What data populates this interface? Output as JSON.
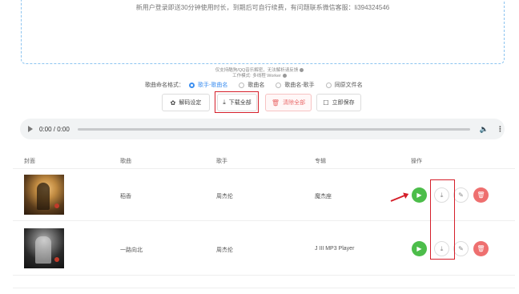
{
  "notice": "新用户登录即送30分钟使用时长，到期后可自行续费，有问题联系微信客服：li394324546",
  "process_note": {
    "line1": "仅支持酷狗/QQ音乐解密，无法解析请反馈",
    "line2": "工作模式: 多线程 Worker"
  },
  "format": {
    "label": "歌曲命名格式：",
    "options": [
      {
        "label": "歌手-歌曲名",
        "selected": true
      },
      {
        "label": "歌曲名",
        "selected": false
      },
      {
        "label": "歌曲名-歌手",
        "selected": false
      },
      {
        "label": "同原文件名",
        "selected": false
      }
    ]
  },
  "toolbar": {
    "settings": "解码设定",
    "download_all": "下载全部",
    "clear_all": "清除全部",
    "instant_save": "立即保存"
  },
  "player": {
    "time": "0:00 / 0:00"
  },
  "table": {
    "headers": [
      "封面",
      "歌曲",
      "歌手",
      "专辑",
      "操作"
    ],
    "rows": [
      {
        "title": "稻香",
        "artist": "周杰伦",
        "album": "魔杰座"
      },
      {
        "title": "一路向北",
        "artist": "周杰伦",
        "album": "J III MP3 Player"
      }
    ]
  },
  "icons": {
    "settings": "gear-icon",
    "download": "download-icon",
    "clear": "trash-icon",
    "save": "checkbox-icon",
    "play": "play-icon",
    "edit": "pencil-icon",
    "delete": "trash-icon",
    "volume": "volume-icon",
    "more": "more-vertical-icon"
  },
  "colors": {
    "accent": "#3b8ef0",
    "play": "#4cbd4a",
    "delete": "#ee6f6f",
    "annotation": "#d51f2a"
  }
}
